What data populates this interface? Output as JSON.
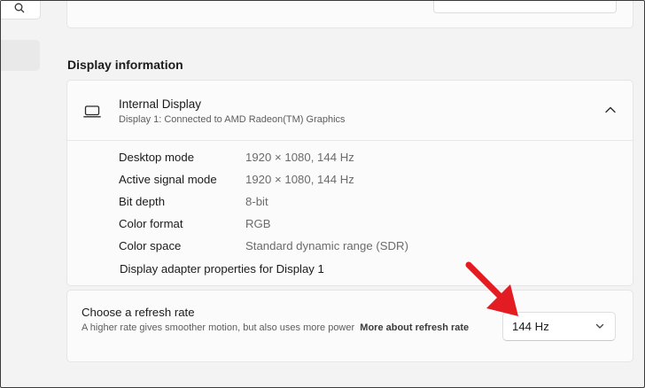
{
  "section": {
    "title": "Display information"
  },
  "display": {
    "name": "Internal Display",
    "subtitle": "Display 1: Connected to AMD Radeon(TM) Graphics"
  },
  "info_rows": [
    {
      "label": "Desktop mode",
      "value": "1920 × 1080, 144 Hz"
    },
    {
      "label": "Active signal mode",
      "value": "1920 × 1080, 144 Hz"
    },
    {
      "label": "Bit depth",
      "value": "8-bit"
    },
    {
      "label": "Color format",
      "value": "RGB"
    },
    {
      "label": "Color space",
      "value": "Standard dynamic range (SDR)"
    }
  ],
  "adapter_link": "Display adapter properties for Display 1",
  "refresh": {
    "title": "Choose a refresh rate",
    "description": "A higher rate gives smoother motion, but also uses more power",
    "link": "More about refresh rate",
    "selected": "144 Hz"
  },
  "icons": {
    "search": "search-icon",
    "monitor": "laptop-icon",
    "collapse": "chevron-up-icon",
    "dropdown": "chevron-down-icon",
    "annotation": "red-arrow"
  },
  "colors": {
    "annotation_arrow": "#e31b23"
  }
}
